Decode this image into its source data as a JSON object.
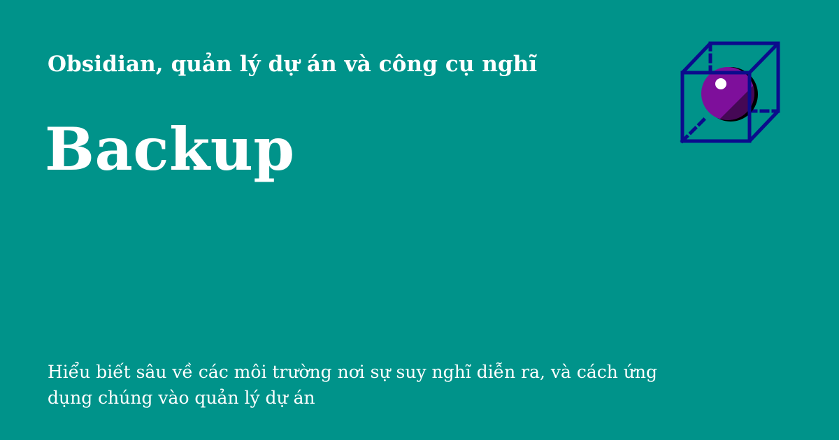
{
  "colors": {
    "background": "#00938A",
    "text": "#FFFFFF",
    "logo_cube": "#0B0B8C",
    "logo_sphere": "#7E0F9B",
    "logo_sphere_shadow": "#000000"
  },
  "header": {
    "site_title": "Obsidian, quản lý dự án và công cụ nghĩ"
  },
  "main": {
    "page_title": "Backup"
  },
  "footer": {
    "description": "Hiểu biết sâu về các môi trường nơi sự suy nghĩ diễn ra, và cách ứng dụng chúng vào quản lý dự án"
  },
  "logo": {
    "icon": "cube-with-sphere-icon"
  }
}
